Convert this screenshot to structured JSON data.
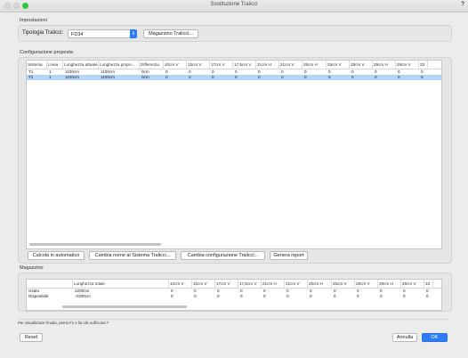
{
  "window": {
    "title": "Sostituzione Tralicci",
    "help": "?"
  },
  "settings": {
    "section_label": "Impostazioni",
    "type_label": "Tipologia Tralicci:",
    "type_value": "FD34",
    "store_button": "Magazzino Tralicci..."
  },
  "config": {
    "section_label": "Configurazione proposta",
    "columns": [
      "Sistema",
      "Linea",
      "Lunghezza attuale",
      "Lunghezza propo...",
      "Differenza",
      "10cm V",
      "15cm V",
      "17cm V",
      "17,5cm V",
      "21cm H",
      "21cm V",
      "25cm H",
      "25cm V",
      "28cm V",
      "29cm H",
      "29cm V",
      "33"
    ],
    "rows": [
      [
        "T1",
        "1",
        "1100cm",
        "1100cm",
        "0cm",
        "0",
        "0",
        "0",
        "0",
        "0",
        "0",
        "0",
        "0",
        "0",
        "0",
        "0",
        "0"
      ],
      [
        "T2",
        "1",
        "1100cm",
        "1100cm",
        "0cm",
        "0",
        "0",
        "0",
        "0",
        "0",
        "0",
        "0",
        "0",
        "0",
        "0",
        "0",
        "0"
      ]
    ],
    "buttons": {
      "auto": "Calcola in automatico",
      "rename": "Cambia nome al Sistema Tralicci...",
      "change": "Cambia configurazione Tralicci...",
      "report": "Genera report"
    }
  },
  "warehouse": {
    "section_label": "Magazzino",
    "columns": [
      "",
      "Lunghezza totale",
      "10cm V",
      "15cm V",
      "17cm V",
      "17,5cm V",
      "21cm H",
      "21cm V",
      "25cm H",
      "25cm V",
      "28cm V",
      "29cm H",
      "29cm V",
      "33"
    ],
    "rows": [
      [
        "Usato",
        "2200cm",
        "0",
        "0",
        "0",
        "0",
        "0",
        "0",
        "0",
        "0",
        "0",
        "0",
        "0",
        "0"
      ],
      [
        "Disponibile",
        "-2200cm",
        "0",
        "0",
        "0",
        "0",
        "0",
        "0",
        "0",
        "0",
        "0",
        "0",
        "0",
        "0"
      ]
    ]
  },
  "status_text": "Per visualizzare l'inudo, premi F1 e fai clic sull'icona ?",
  "footer": {
    "reset": "Reset",
    "cancel": "Annulla",
    "ok": "OK"
  },
  "colors": {
    "accent": "#2d7cf6",
    "selection": "#b5d5fb"
  }
}
